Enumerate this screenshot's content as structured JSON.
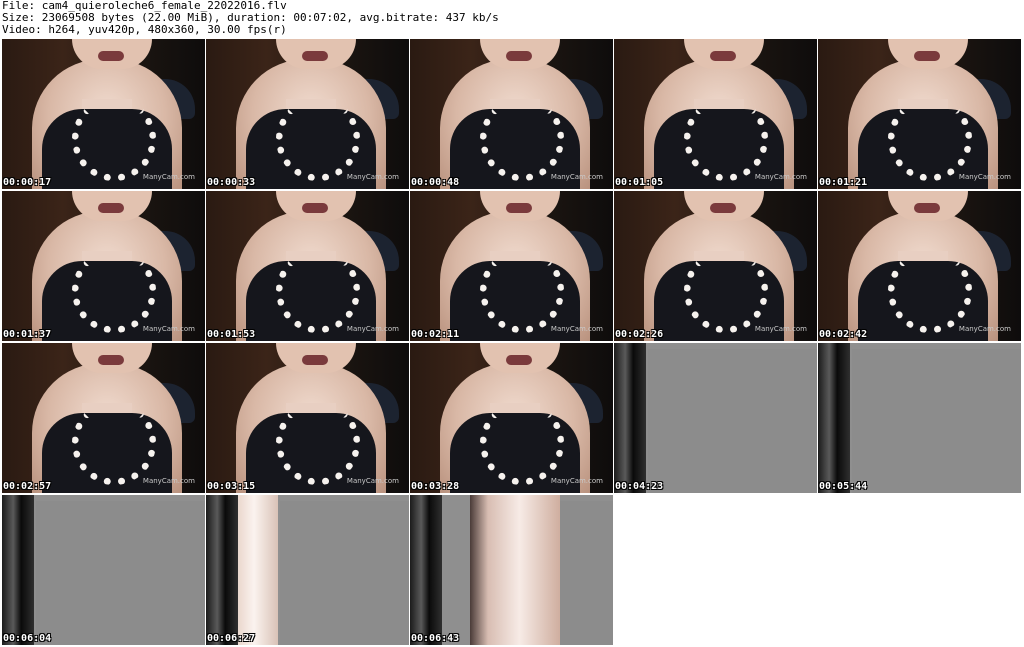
{
  "header": {
    "file_line": "File: cam4_quieroleche6_female_22022016.flv",
    "size_line": "Size: 23069508 bytes (22.00 MiB), duration: 00:07:02, avg.bitrate: 437 kb/s",
    "video_line": "Video: h264, yuv420p, 480x360, 30.00 fps(r)"
  },
  "thumbnails": [
    {
      "timestamp": "00:00:17",
      "kind": "scene",
      "watermark": "ManyCam.com"
    },
    {
      "timestamp": "00:00:33",
      "kind": "scene",
      "watermark": "ManyCam.com"
    },
    {
      "timestamp": "00:00:48",
      "kind": "scene",
      "watermark": "ManyCam.com"
    },
    {
      "timestamp": "00:01:05",
      "kind": "scene",
      "watermark": "ManyCam.com"
    },
    {
      "timestamp": "00:01:21",
      "kind": "scene",
      "watermark": "ManyCam.com"
    },
    {
      "timestamp": "00:01:37",
      "kind": "scene",
      "watermark": "ManyCam.com"
    },
    {
      "timestamp": "00:01:53",
      "kind": "scene",
      "watermark": "ManyCam.com"
    },
    {
      "timestamp": "00:02:11",
      "kind": "scene",
      "watermark": "ManyCam.com"
    },
    {
      "timestamp": "00:02:26",
      "kind": "scene",
      "watermark": "ManyCam.com"
    },
    {
      "timestamp": "00:02:42",
      "kind": "scene",
      "watermark": "ManyCam.com"
    },
    {
      "timestamp": "00:02:57",
      "kind": "scene",
      "watermark": "ManyCam.com"
    },
    {
      "timestamp": "00:03:15",
      "kind": "scene",
      "watermark": "ManyCam.com"
    },
    {
      "timestamp": "00:03:28",
      "kind": "scene",
      "watermark": "ManyCam.com"
    },
    {
      "timestamp": "00:04:23",
      "kind": "gray",
      "watermark": ""
    },
    {
      "timestamp": "00:05:44",
      "kind": "gray",
      "watermark": ""
    },
    {
      "timestamp": "00:06:04",
      "kind": "gray",
      "watermark": ""
    },
    {
      "timestamp": "00:06:27",
      "kind": "gray-alt",
      "watermark": ""
    },
    {
      "timestamp": "00:06:43",
      "kind": "gray-wide",
      "watermark": ""
    }
  ]
}
